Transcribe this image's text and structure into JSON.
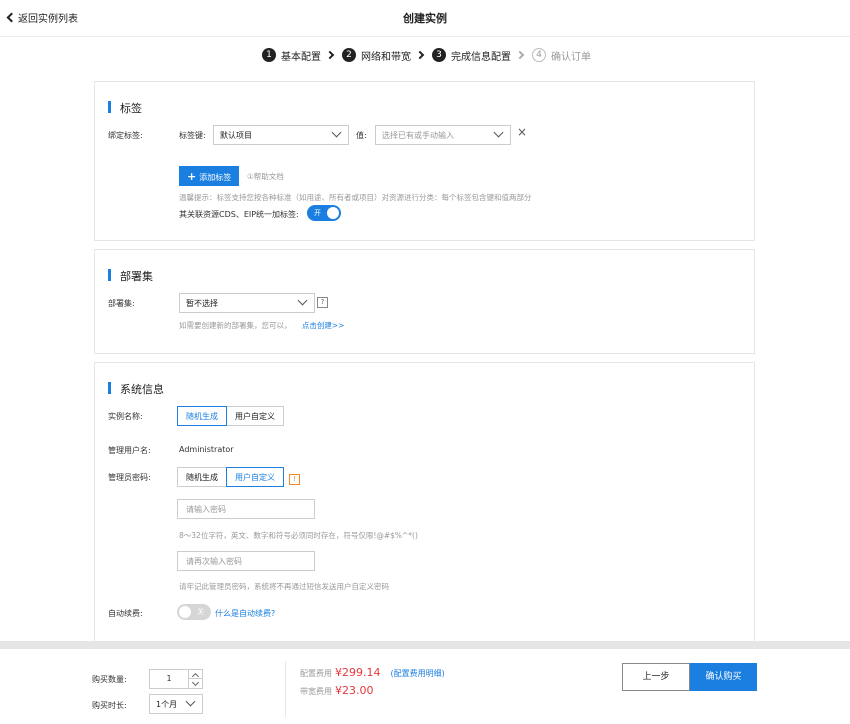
{
  "header": {
    "back_label": "返回实例列表",
    "title": "创建实例"
  },
  "steps": [
    {
      "num": "1",
      "label": "基本配置"
    },
    {
      "num": "2",
      "label": "网络和带宽"
    },
    {
      "num": "3",
      "label": "完成信息配置"
    },
    {
      "num": "4",
      "label": "确认订单"
    }
  ],
  "tags": {
    "title": "标签",
    "bind_label": "绑定标签:",
    "key_label": "标签键:",
    "key_value": "默认项目",
    "value_label": "值:",
    "value_placeholder": "选择已有或手动输入",
    "remove_icon": "×",
    "add_button": "添加标签",
    "help_doc": "①帮助文档",
    "tip": "温馨提示：标签支持您按各种标准（如用途、所有者或项目）对资源进行分类：每个标签包含键和值两部分",
    "cds_eip_label": "其关联资源CDS、EIP统一加标签:",
    "toggle_on": "开"
  },
  "deployset": {
    "title": "部署集",
    "label": "部署集:",
    "value": "暂不选择",
    "help_icon": "?",
    "hint": "如需要创建新的部署集，您可以，",
    "create_link": "点击创建>>"
  },
  "sysinfo": {
    "title": "系统信息",
    "instance_name_label": "实例名称:",
    "name_opt_random": "随机生成",
    "name_opt_custom": "用户自定义",
    "admin_user_label": "管理用户名:",
    "admin_user_value": "Administrator",
    "admin_pwd_label": "管理员密码:",
    "pwd_opt_random": "随机生成",
    "pwd_opt_custom": "用户自定义",
    "pwd_warn_icon": "!",
    "pwd_placeholder": "请输入密码",
    "pwd_rule": "8～32位字符，英文、数字和符号必须同时存在，符号仅限!@#$%^*()",
    "pwd_confirm_placeholder": "请再次输入密码",
    "pwd_note": "请牢记此管理员密码，系统将不再通过短信发送用户自定义密码",
    "autorenew_label": "自动续费:",
    "toggle_off": "关",
    "autorenew_link": "什么是自动续费?"
  },
  "footer": {
    "qty_label": "购买数量:",
    "qty_value": "1",
    "duration_label": "购买时长:",
    "duration_value": "1个月",
    "config_fee_label": "配置费用",
    "config_fee": "¥299.14",
    "config_fee_detail": "(配置费用明细)",
    "bandwidth_fee_label": "带宽费用",
    "bandwidth_fee": "¥23.00",
    "prev_button": "上一步",
    "buy_button": "确认购买"
  },
  "colors": {
    "accent": "#1a7fe0",
    "price": "#e4393c",
    "warn": "#f08a24"
  }
}
